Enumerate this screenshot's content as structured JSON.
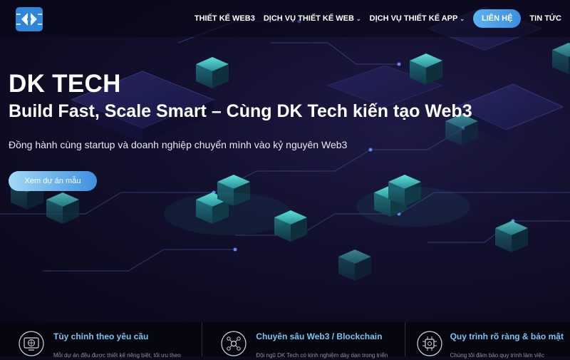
{
  "navbar": {
    "logo": "dk-tech-logo",
    "items": [
      {
        "label": "THIẾT KẾ WEB3",
        "has_dropdown": false
      },
      {
        "label": "DỊCH VỤ THIẾT KẾ WEB",
        "has_dropdown": true
      },
      {
        "label": "DỊCH VỤ THIẾT KẾ APP",
        "has_dropdown": true
      }
    ],
    "contact_label": "LIÊN HỆ",
    "news_label": "TIN TỨC"
  },
  "hero": {
    "brand": "DK TECH",
    "title": "Build Fast, Scale Smart – Cùng DK Tech kiến tạo Web3",
    "subtitle": "Đồng hành cùng startup và doanh nghiệp chuyển mình vào kỷ nguyên Web3",
    "cta_label": "Xem dự án mẫu"
  },
  "features": [
    {
      "icon": "globe-icon",
      "title": "Tùy chỉnh theo yêu cầu",
      "desc": "Mỗi dự án đều được thiết kế riêng biệt, tối ưu theo"
    },
    {
      "icon": "network-icon",
      "title": "Chuyên sâu Web3 / Blockchain",
      "desc": "Đội ngũ DK Tech có kinh nghiệm dày dạn trong triển"
    },
    {
      "icon": "chip-icon",
      "title": "Quy trình rõ ràng & bảo mật",
      "desc": "Chúng tôi đảm bảo quy trình làm việc"
    }
  ],
  "colors": {
    "accent": "#4aa3e8",
    "feature_title": "#7cc4f0",
    "background": "#0c0a1c"
  }
}
